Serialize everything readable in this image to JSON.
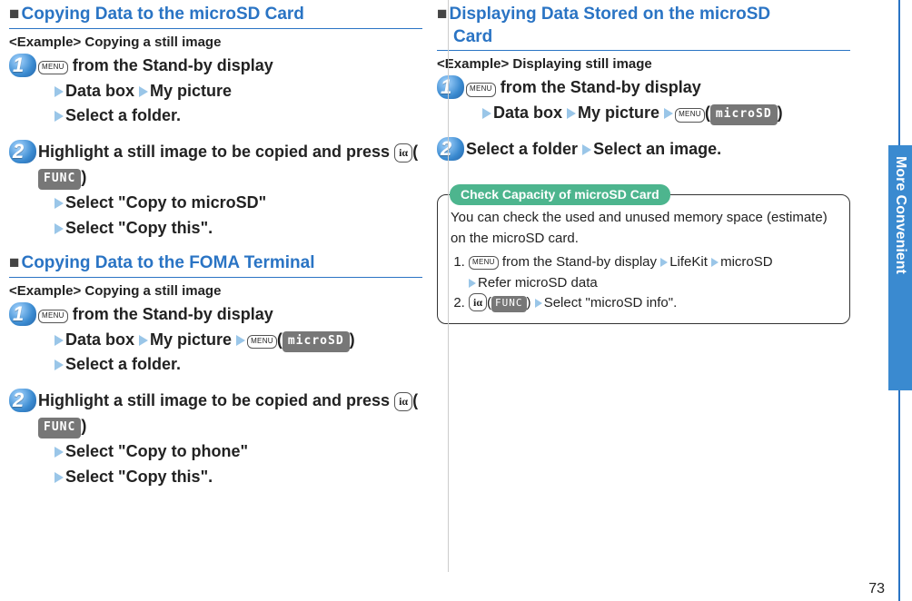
{
  "left": {
    "section1": {
      "title": "Copying Data to the microSD Card",
      "example": "<Example> Copying a still image",
      "step1": {
        "line1_after_menu": " from the Stand-by display",
        "line2_a": "Data box",
        "line2_b": "My picture",
        "line3": "Select a folder."
      },
      "step2": {
        "line1": "Highlight a still image to be copied and press ",
        "func": "FUNC",
        "line2": "Select \"Copy to microSD\"",
        "line3": "Select \"Copy this\"."
      }
    },
    "section2": {
      "title": "Copying Data to the FOMA Terminal",
      "example": "<Example> Copying a still image",
      "step1": {
        "line1_after_menu": " from the Stand-by display",
        "line2_a": "Data box",
        "line2_b": "My picture",
        "microsd": "microSD",
        "line3": "Select a folder."
      },
      "step2": {
        "line1": "Highlight a still image to be copied and press ",
        "func": "FUNC",
        "line2": "Select \"Copy to phone\"",
        "line3": "Select \"Copy this\"."
      }
    }
  },
  "right": {
    "section1": {
      "title_l1": "Displaying Data Stored on the microSD ",
      "title_l2": "Card",
      "example": "<Example> Displaying still image",
      "step1": {
        "line1_after_menu": " from the Stand-by display",
        "line2_a": "Data box",
        "line2_b": "My picture",
        "microsd": "microSD"
      },
      "step2": {
        "line1_a": "Select a folder",
        "line1_b": "Select an image."
      }
    },
    "tip": {
      "title": "Check Capacity of microSD Card",
      "body": "You can check the used and unused memory space (estimate) on the microSD card.",
      "li1_a": " from the Stand-by display",
      "li1_b": "LifeKit",
      "li1_c": "microSD",
      "li1_d": "Refer microSD data",
      "func": "FUNC",
      "li2_a": "Select \"microSD info\"."
    }
  },
  "labels": {
    "menu": "MENU",
    "i_mark": "iα"
  },
  "side_tab": "More Convenient",
  "page_number": "73"
}
